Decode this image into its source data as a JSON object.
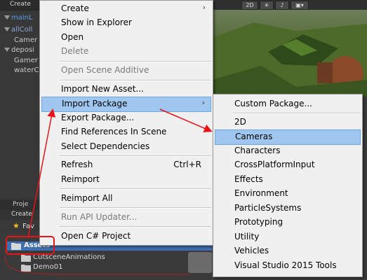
{
  "hierarchy": {
    "toolbar_label": "Create",
    "items": [
      "mainL",
      "allColl",
      "Camer",
      "deposi",
      "Gamer",
      "waterC"
    ]
  },
  "scene": {
    "btn_2d": "2D",
    "sun_icon": "sun-icon",
    "image_icon": "image-icon"
  },
  "project": {
    "header": "Proje",
    "toolbar_label": "Create",
    "favorites": "Fav",
    "assets": "Assets",
    "tree": [
      "CutsceneAnimations",
      "Demo01"
    ]
  },
  "context_menu": {
    "items": [
      {
        "label": "Create",
        "arrow": "›"
      },
      {
        "label": "Show in Explorer"
      },
      {
        "label": "Open"
      },
      {
        "label": "Delete"
      },
      {
        "label": "Open Scene Additive"
      },
      {
        "label": "Import New Asset..."
      },
      {
        "label": "Import Package",
        "arrow": "›"
      },
      {
        "label": "Export Package..."
      },
      {
        "label": "Find References In Scene"
      },
      {
        "label": "Select Dependencies"
      },
      {
        "label": "Refresh",
        "shortcut": "Ctrl+R"
      },
      {
        "label": "Reimport"
      },
      {
        "label": "Reimport All"
      },
      {
        "label": "Run API Updater..."
      },
      {
        "label": "Open C# Project"
      }
    ]
  },
  "import_package_menu": {
    "items": [
      {
        "label": "Custom Package..."
      },
      {
        "label": "2D"
      },
      {
        "label": "Cameras"
      },
      {
        "label": "Characters"
      },
      {
        "label": "CrossPlatformInput"
      },
      {
        "label": "Effects"
      },
      {
        "label": "Environment"
      },
      {
        "label": "ParticleSystems"
      },
      {
        "label": "Prototyping"
      },
      {
        "label": "Utility"
      },
      {
        "label": "Vehicles"
      },
      {
        "label": "Visual Studio 2015 Tools"
      }
    ]
  },
  "colors": {
    "highlight": "#9ec6ee",
    "selection": "#3e6fb0",
    "annotation": "#e8141a"
  }
}
